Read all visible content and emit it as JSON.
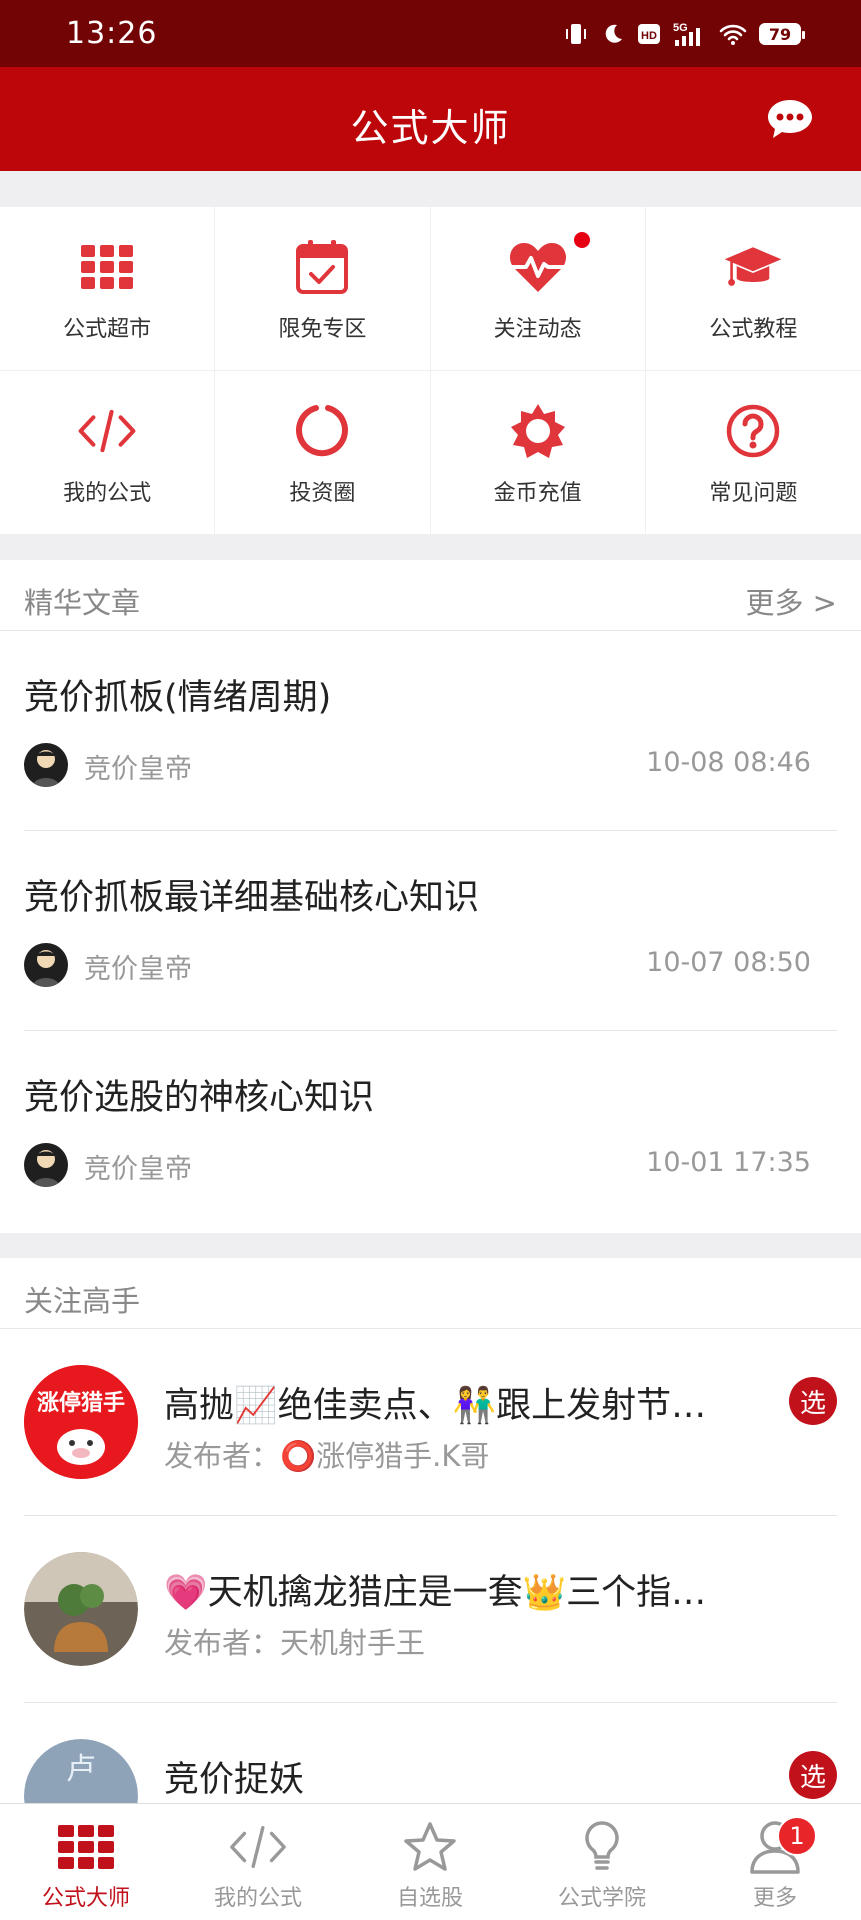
{
  "status_bar": {
    "time": "13:26",
    "battery": "79"
  },
  "header": {
    "title": "公式大师"
  },
  "grid": [
    {
      "label": "公式超市",
      "icon": "grid-icon"
    },
    {
      "label": "限免专区",
      "icon": "calendar-check-icon"
    },
    {
      "label": "关注动态",
      "icon": "heartbeat-icon"
    },
    {
      "label": "公式教程",
      "icon": "graduation-cap-icon"
    },
    {
      "label": "我的公式",
      "icon": "code-icon"
    },
    {
      "label": "投资圈",
      "icon": "circle-ring-icon"
    },
    {
      "label": "金币充值",
      "icon": "gear-sun-icon"
    },
    {
      "label": "常见问题",
      "icon": "question-icon"
    }
  ],
  "articles_section": {
    "title": "精华文章",
    "more": "更多 >",
    "items": [
      {
        "title": "竞价抓板(情绪周期)",
        "author": "竞价皇帝",
        "time": "10-08 08:46"
      },
      {
        "title": "竞价抓板最详细基础核心知识",
        "author": "竞价皇帝",
        "time": "10-07 08:50"
      },
      {
        "title": "竞价选股的神核心知识",
        "author": "竞价皇帝",
        "time": "10-01 17:35"
      }
    ]
  },
  "experts_section": {
    "title": "关注高手",
    "items": [
      {
        "title": "高抛📈绝佳卖点、👫跟上发射节…",
        "publisher": "发布者：⭕涨停猎手.K哥",
        "badge": "选",
        "avatar_text": "涨停猎手"
      },
      {
        "title": "💗天机擒龙猎庄是一套👑三个指…",
        "publisher": "发布者：天机射手王",
        "badge": "",
        "avatar_text": ""
      },
      {
        "title": "竞价捉妖",
        "publisher": "",
        "badge": "选",
        "avatar_text": "卢"
      }
    ]
  },
  "bottom_nav": [
    {
      "label": "公式大师",
      "active": true
    },
    {
      "label": "我的公式",
      "active": false
    },
    {
      "label": "自选股",
      "active": false
    },
    {
      "label": "公式学院",
      "active": false
    },
    {
      "label": "更多",
      "active": false,
      "badge": "1"
    }
  ],
  "colors": {
    "primary": "#bd0609",
    "status_bar": "#720406",
    "accent_red": "#e0353a"
  }
}
